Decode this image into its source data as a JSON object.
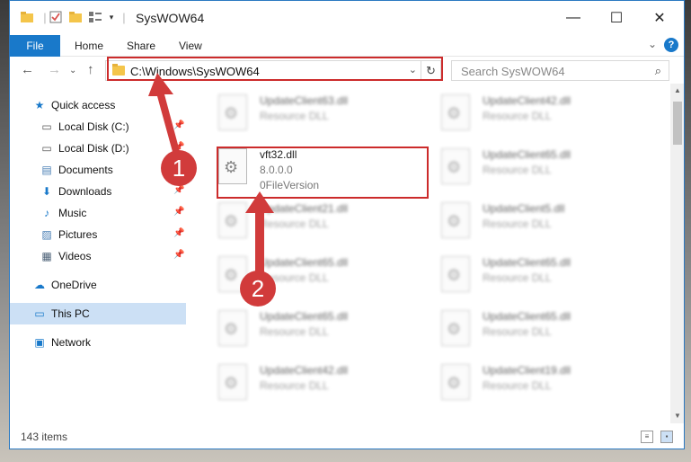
{
  "window": {
    "title": "SysWOW64",
    "controls": {
      "minimize": "—",
      "maximize": "☐",
      "close": "✕"
    }
  },
  "ribbon": {
    "tabs": [
      "File",
      "Home",
      "Share",
      "View"
    ],
    "expand_glyph": "⌄",
    "help_glyph": "?"
  },
  "navigation": {
    "back": "←",
    "forward": "→",
    "recent": "⌄",
    "up": "↑",
    "address": "C:\\Windows\\SysWOW64",
    "dropdown": "⌄",
    "refresh": "↻",
    "search_placeholder": "Search SysWOW64",
    "search_glyph": "⌕"
  },
  "sidebar": {
    "items": [
      {
        "label": "Quick access",
        "icon": "star-icon",
        "glyph": "★",
        "color": "#1979ca",
        "pinned": false
      },
      {
        "label": "Local Disk (C:)",
        "icon": "drive-icon",
        "glyph": "▭",
        "color": "#555555",
        "pinned": true
      },
      {
        "label": "Local Disk (D:)",
        "icon": "drive-icon",
        "glyph": "▭",
        "color": "#555555",
        "pinned": true
      },
      {
        "label": "Documents",
        "icon": "documents-icon",
        "glyph": "▤",
        "color": "#4a7fb5",
        "pinned": true
      },
      {
        "label": "Downloads",
        "icon": "download-icon",
        "glyph": "⬇",
        "color": "#1979ca",
        "pinned": true
      },
      {
        "label": "Music",
        "icon": "music-icon",
        "glyph": "♪",
        "color": "#1979ca",
        "pinned": true
      },
      {
        "label": "Pictures",
        "icon": "pictures-icon",
        "glyph": "▨",
        "color": "#4a7fb5",
        "pinned": true
      },
      {
        "label": "Videos",
        "icon": "videos-icon",
        "glyph": "▦",
        "color": "#4a5f75",
        "pinned": true
      },
      {
        "label": "OneDrive",
        "icon": "cloud-icon",
        "glyph": "☁",
        "color": "#1979ca",
        "pinned": false
      },
      {
        "label": "This PC",
        "icon": "computer-icon",
        "glyph": "▭",
        "color": "#1979ca",
        "pinned": false
      },
      {
        "label": "Network",
        "icon": "network-icon",
        "glyph": "▣",
        "color": "#1979ca",
        "pinned": false
      }
    ],
    "pin_glyph": "📌"
  },
  "files": {
    "highlighted": {
      "name": "vft32.dll",
      "version": "8.0.0.0",
      "description": "0FileVersion"
    },
    "left_column": [
      {
        "name": "UpdateClient63.dll",
        "type": "Resource DLL"
      },
      {
        "name": "UpdateClient21.dll",
        "type": "Resource DLL"
      },
      {
        "name": "UpdateClient65.dll",
        "type": "Resource DLL"
      },
      {
        "name": "UpdateClient65.dll",
        "type": "Resource DLL"
      },
      {
        "name": "UpdateClient42.dll",
        "type": "Resource DLL"
      }
    ],
    "right_column": [
      {
        "name": "UpdateClient42.dll",
        "type": "Resource DLL"
      },
      {
        "name": "UpdateClient65.dll",
        "type": "Resource DLL"
      },
      {
        "name": "UpdateClient5.dll",
        "type": "Resource DLL"
      },
      {
        "name": "UpdateClient65.dll",
        "type": "Resource DLL"
      },
      {
        "name": "UpdateClient65.dll",
        "type": "Resource DLL"
      },
      {
        "name": "UpdateClient19.dll",
        "type": "Resource DLL"
      }
    ]
  },
  "status": {
    "item_count": "143 items"
  },
  "annotations": {
    "step1": "1",
    "step2": "2",
    "color": "#d13b3b"
  }
}
